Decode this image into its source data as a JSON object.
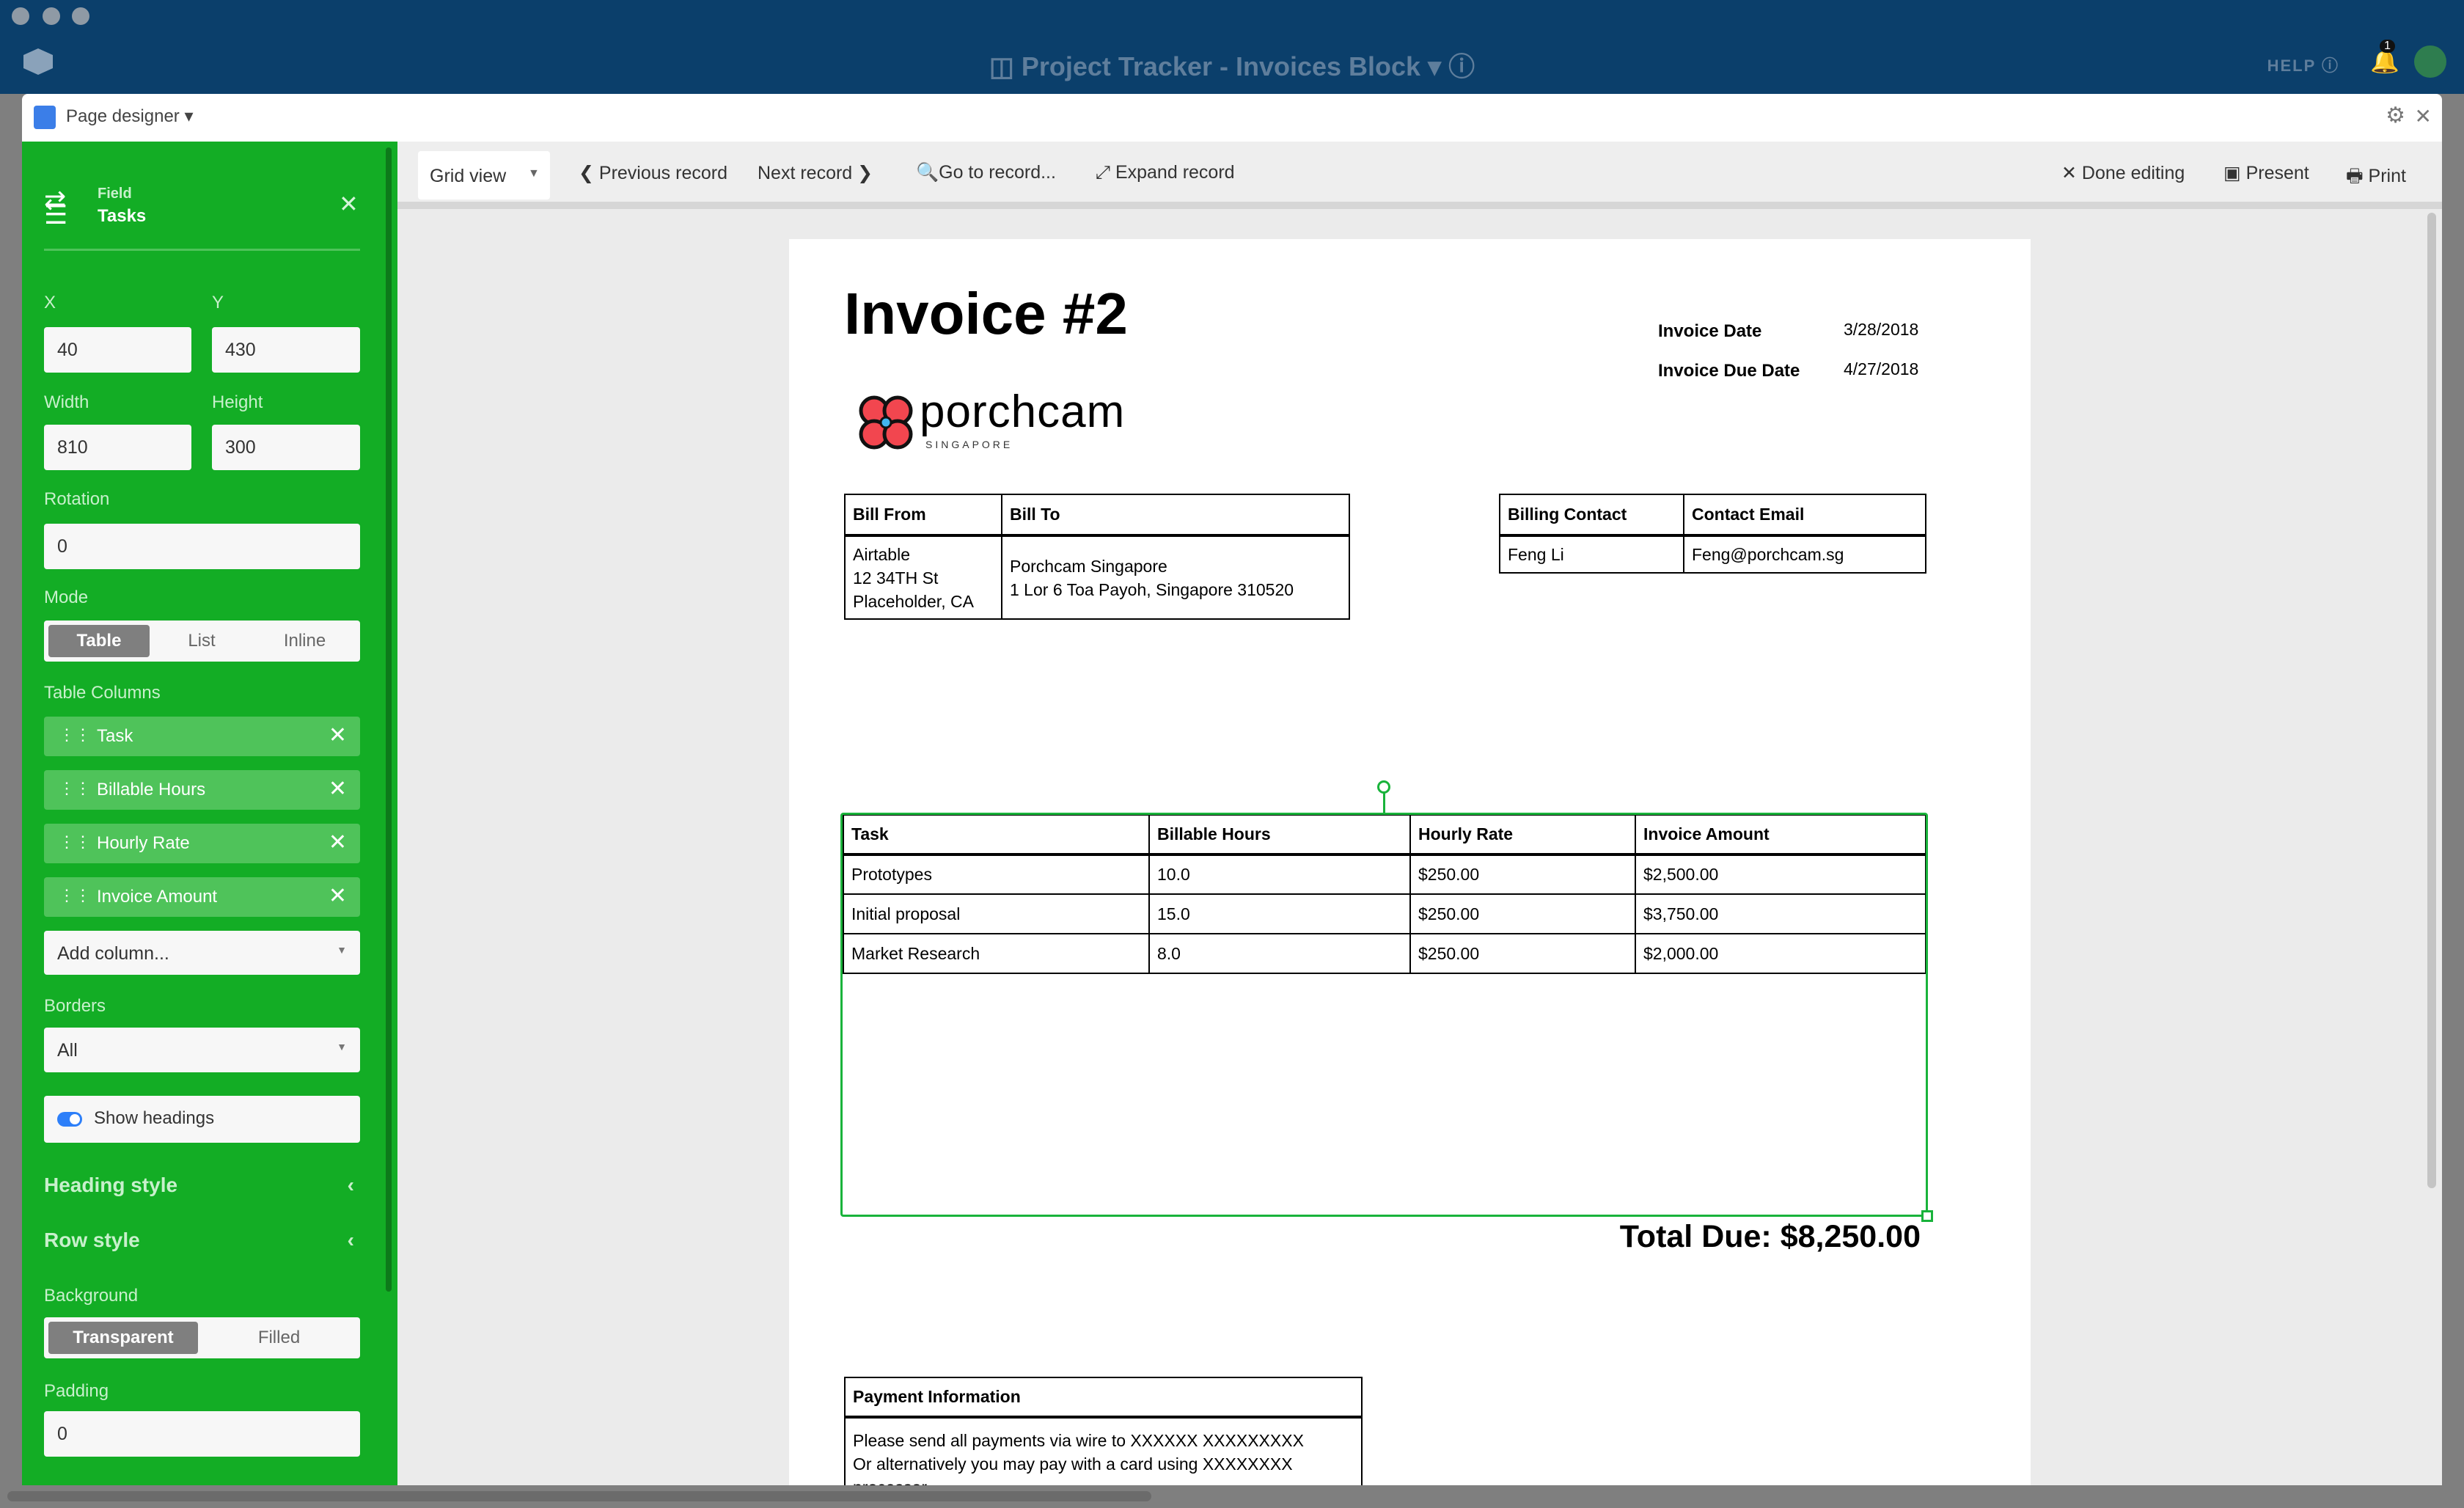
{
  "window": {
    "title": "Project Tracker - Invoices Block",
    "help": "HELP",
    "notification_count": "1"
  },
  "designer": {
    "title": "Page designer"
  },
  "panel": {
    "kind": "Field",
    "field": "Tasks",
    "x_label": "X",
    "x": "40",
    "y_label": "Y",
    "y": "430",
    "width_label": "Width",
    "width": "810",
    "height_label": "Height",
    "height": "300",
    "rotation_label": "Rotation",
    "rotation": "0",
    "mode_label": "Mode",
    "modes": [
      "Table",
      "List",
      "Inline"
    ],
    "mode_selected": "Table",
    "columns_label": "Table Columns",
    "columns": [
      "Task",
      "Billable Hours",
      "Hourly Rate",
      "Invoice Amount"
    ],
    "add_column": "Add column...",
    "borders_label": "Borders",
    "borders": "All",
    "show_headings": "Show headings",
    "show_headings_on": true,
    "heading_style": "Heading style",
    "row_style": "Row style",
    "background_label": "Background",
    "backgrounds": [
      "Transparent",
      "Filled"
    ],
    "background_selected": "Transparent",
    "padding_label": "Padding",
    "padding": "0",
    "accent": "#13ad25"
  },
  "toolbar": {
    "view": "Grid view",
    "prev": "Previous record",
    "next": "Next record",
    "goto": "Go to record...",
    "expand": "Expand record",
    "done": "Done editing",
    "present": "Present",
    "print": "Print"
  },
  "invoice": {
    "title": "Invoice #2",
    "date_label": "Invoice Date",
    "date": "3/28/2018",
    "due_label": "Invoice Due Date",
    "due": "4/27/2018",
    "logo": {
      "name": "porchcam",
      "sub": "SINGAPORE"
    },
    "bill": {
      "from_h": "Bill From",
      "to_h": "Bill To",
      "from": [
        "Airtable",
        "12 34TH St",
        "Placeholder, CA"
      ],
      "to": [
        "Porchcam Singapore",
        "1 Lor 6 Toa Payoh, Singapore 310520"
      ]
    },
    "contact": {
      "name_h": "Billing Contact",
      "email_h": "Contact Email",
      "name": "Feng Li",
      "email": "Feng@porchcam.sg"
    },
    "tasks": {
      "headers": [
        "Task",
        "Billable Hours",
        "Hourly Rate",
        "Invoice Amount"
      ],
      "rows": [
        [
          "Prototypes",
          "10.0",
          "$250.00",
          "$2,500.00"
        ],
        [
          "Initial proposal",
          "15.0",
          "$250.00",
          "$3,750.00"
        ],
        [
          "Market Research",
          "8.0",
          "$250.00",
          "$2,000.00"
        ]
      ]
    },
    "total": "Total Due: $8,250.00",
    "payment": {
      "header": "Payment Information",
      "lines": [
        "Please send all payments via wire to XXXXXX XXXXXXXXX",
        "Or alternatively you may pay with a card using XXXXXXXX",
        "processor"
      ]
    }
  }
}
